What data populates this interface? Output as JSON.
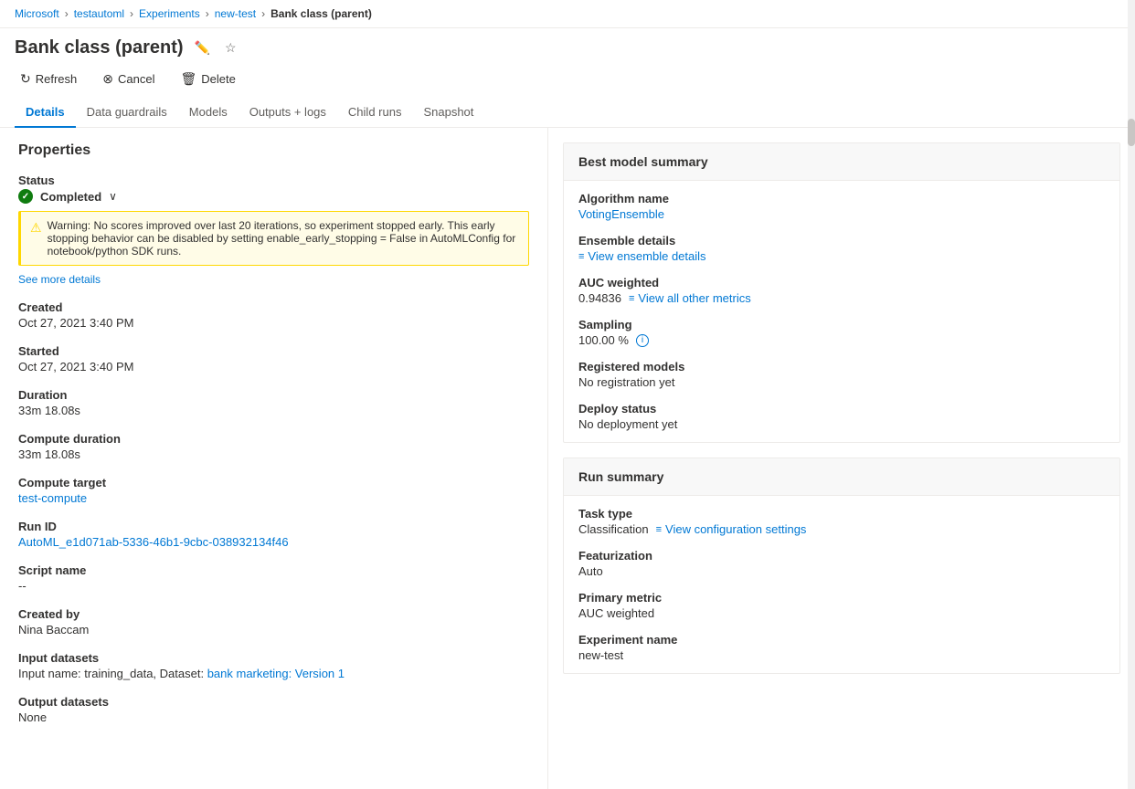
{
  "breadcrumb": {
    "items": [
      {
        "label": "Microsoft",
        "href": "#"
      },
      {
        "label": "testautoml",
        "href": "#"
      },
      {
        "label": "Experiments",
        "href": "#"
      },
      {
        "label": "new-test",
        "href": "#"
      },
      {
        "label": "Bank class (parent)",
        "current": true
      }
    ]
  },
  "page": {
    "title": "Bank class (parent)",
    "edit_tooltip": "Edit",
    "star_tooltip": "Favorite"
  },
  "toolbar": {
    "refresh_label": "Refresh",
    "cancel_label": "Cancel",
    "delete_label": "Delete"
  },
  "tabs": [
    {
      "label": "Details",
      "active": true
    },
    {
      "label": "Data guardrails",
      "active": false
    },
    {
      "label": "Models",
      "active": false
    },
    {
      "label": "Outputs + logs",
      "active": false
    },
    {
      "label": "Child runs",
      "active": false
    },
    {
      "label": "Snapshot",
      "active": false
    }
  ],
  "properties": {
    "section_title": "Properties",
    "status": {
      "label": "Status",
      "value": "Completed"
    },
    "warning": {
      "text": "Warning: No scores improved over last 20 iterations, so experiment stopped early. This early stopping behavior can be disabled by setting enable_early_stopping = False in AutoMLConfig for notebook/python SDK runs."
    },
    "see_more": "See more details",
    "created": {
      "label": "Created",
      "value": "Oct 27, 2021 3:40 PM"
    },
    "started": {
      "label": "Started",
      "value": "Oct 27, 2021 3:40 PM"
    },
    "duration": {
      "label": "Duration",
      "value": "33m 18.08s"
    },
    "compute_duration": {
      "label": "Compute duration",
      "value": "33m 18.08s"
    },
    "compute_target": {
      "label": "Compute target",
      "value": "test-compute"
    },
    "run_id": {
      "label": "Run ID",
      "value": "AutoML_e1d071ab-5336-46b1-9cbc-038932134f46"
    },
    "script_name": {
      "label": "Script name",
      "value": "--"
    },
    "created_by": {
      "label": "Created by",
      "value": "Nina Baccam"
    },
    "input_datasets": {
      "label": "Input datasets",
      "prefix": "Input name: training_data, Dataset: ",
      "link_text": "bank marketing: Version 1"
    },
    "output_datasets": {
      "label": "Output datasets",
      "value": "None"
    }
  },
  "best_model_summary": {
    "title": "Best model summary",
    "algorithm_name": {
      "label": "Algorithm name",
      "value": "VotingEnsemble"
    },
    "ensemble_details": {
      "label": "Ensemble details",
      "link_text": "View ensemble details"
    },
    "auc_weighted": {
      "label": "AUC weighted",
      "value": "0.94836",
      "link_text": "View all other metrics"
    },
    "sampling": {
      "label": "Sampling",
      "value": "100.00 %"
    },
    "registered_models": {
      "label": "Registered models",
      "value": "No registration yet"
    },
    "deploy_status": {
      "label": "Deploy status",
      "value": "No deployment yet"
    }
  },
  "run_summary": {
    "title": "Run summary",
    "task_type": {
      "label": "Task type",
      "value": "Classification",
      "link_text": "View configuration settings"
    },
    "featurization": {
      "label": "Featurization",
      "value": "Auto"
    },
    "primary_metric": {
      "label": "Primary metric",
      "value": "AUC weighted"
    },
    "experiment_name": {
      "label": "Experiment name",
      "value": "new-test"
    }
  }
}
